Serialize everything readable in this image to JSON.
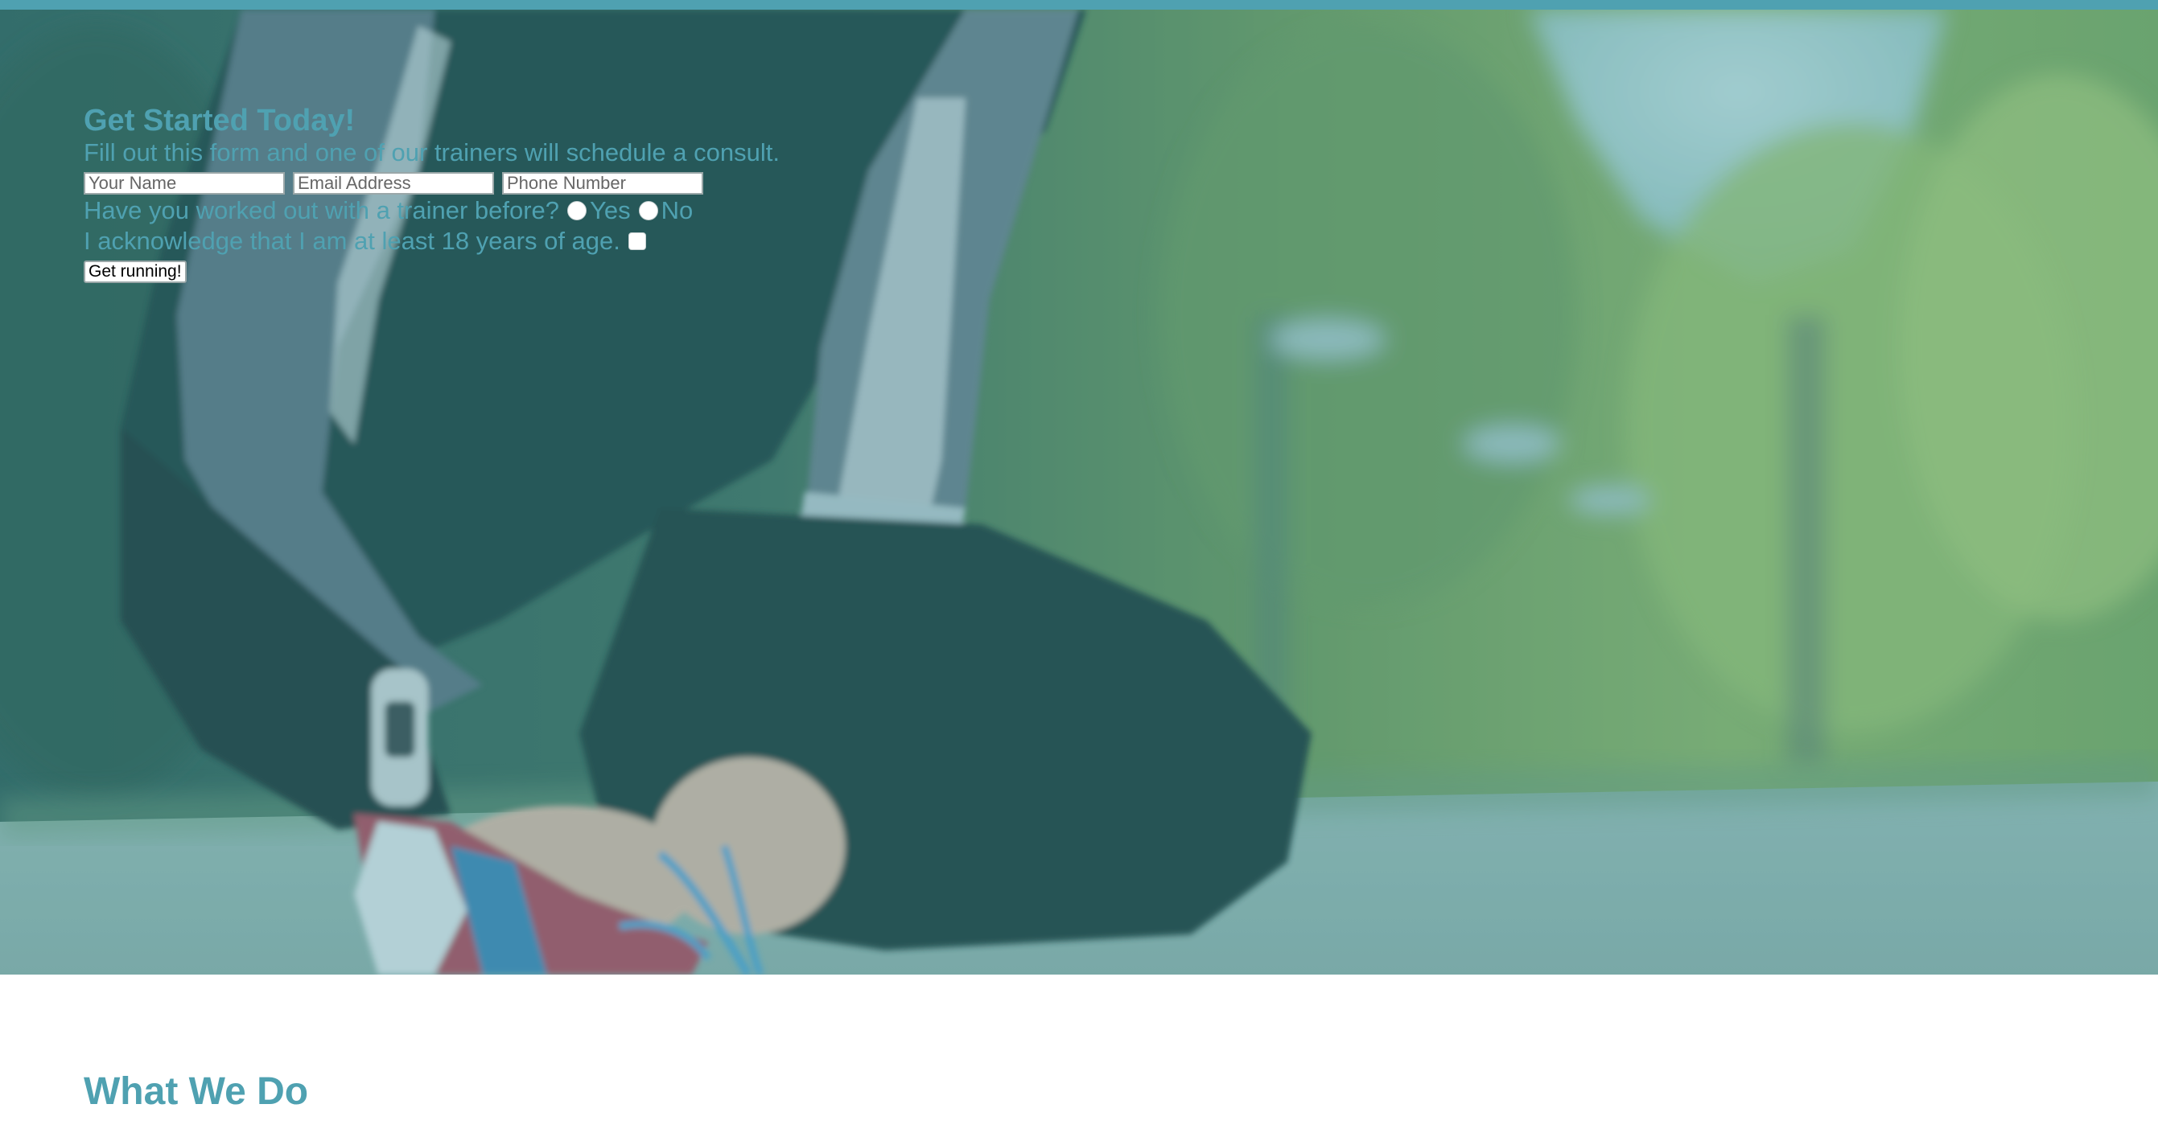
{
  "form": {
    "title": "Get Started Today!",
    "subtitle": "Fill out this form and one of our trainers will schedule a consult.",
    "name_placeholder": "Your Name",
    "email_placeholder": "Email Address",
    "phone_placeholder": "Phone Number",
    "trainer_question": "Have you worked out with a trainer before?",
    "yes_label": "Yes",
    "no_label": "No",
    "age_ack": "I acknowledge that I am at least 18 years of age.",
    "submit_label": "Get running!"
  },
  "section": {
    "title": "What We Do"
  },
  "colors": {
    "accent": "#4fa1b1",
    "background": "#ffffff"
  }
}
